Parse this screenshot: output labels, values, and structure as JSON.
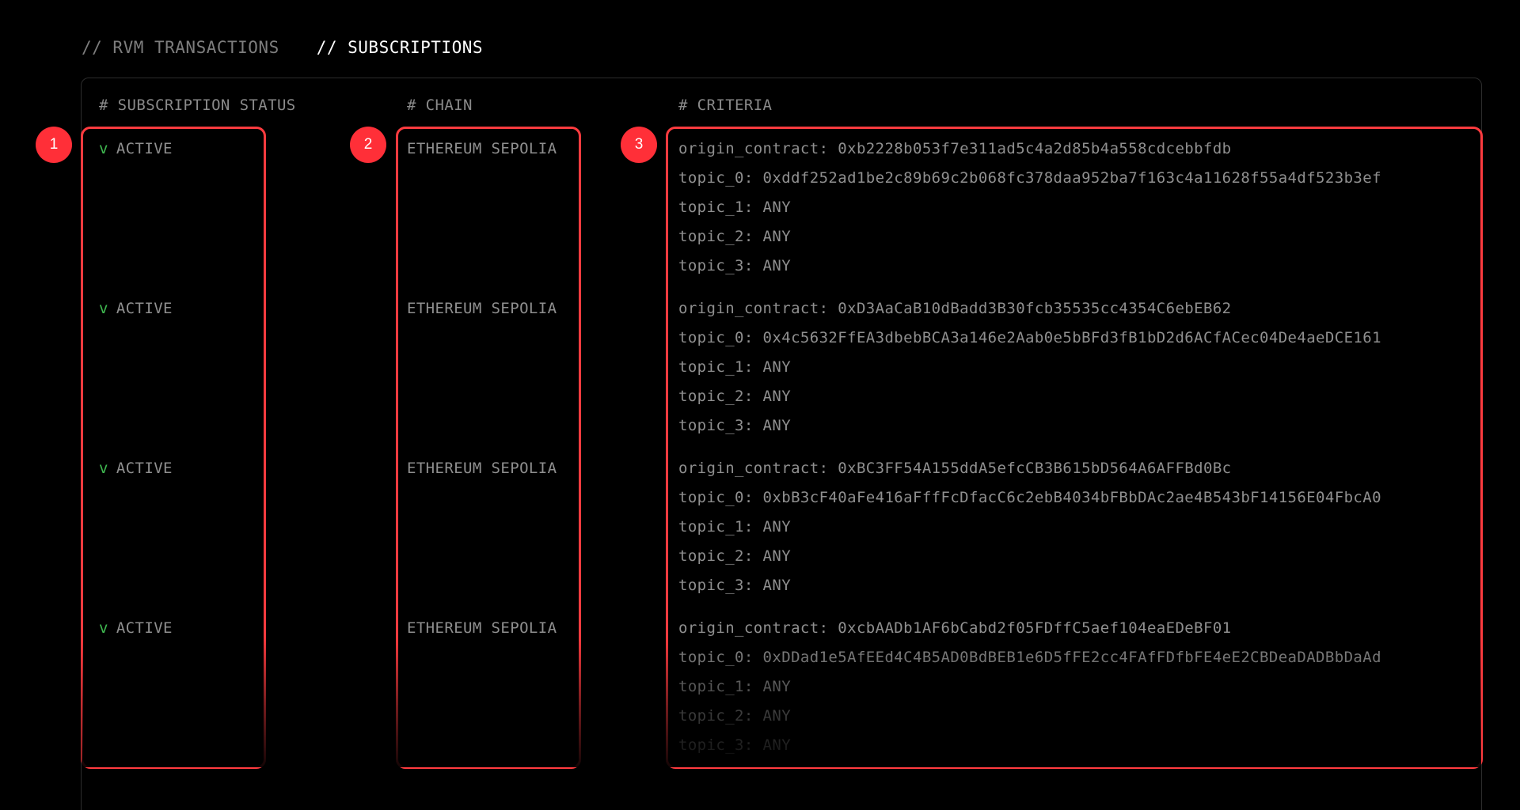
{
  "tabs": [
    {
      "label": "// RVM TRANSACTIONS",
      "active": false
    },
    {
      "label": "// SUBSCRIPTIONS",
      "active": true
    }
  ],
  "columns": {
    "status": "# SUBSCRIPTION STATUS",
    "chain": "# CHAIN",
    "criteria": "# CRITERIA"
  },
  "markers": [
    "1",
    "2",
    "3"
  ],
  "subscriptions": [
    {
      "check": "v",
      "status": "ACTIVE",
      "chain": "ETHEREUM SEPOLIA",
      "criteria": [
        "origin_contract: 0xb2228b053f7e311ad5c4a2d85b4a558cdcebbfdb",
        "topic_0: 0xddf252ad1be2c89b69c2b068fc378daa952ba7f163c4a11628f55a4df523b3ef",
        "topic_1: ANY",
        "topic_2: ANY",
        "topic_3: ANY"
      ]
    },
    {
      "check": "v",
      "status": "ACTIVE",
      "chain": "ETHEREUM SEPOLIA",
      "criteria": [
        "origin_contract: 0xD3AaCaB10dBadd3B30fcb35535cc4354C6ebEB62",
        "topic_0: 0x4c5632FfEA3dbebBCA3a146e2Aab0e5bBFd3fB1bD2d6ACfACec04De4aeDCE161",
        "topic_1: ANY",
        "topic_2: ANY",
        "topic_3: ANY"
      ]
    },
    {
      "check": "v",
      "status": "ACTIVE",
      "chain": "ETHEREUM SEPOLIA",
      "criteria": [
        "origin_contract: 0xBC3FF54A155ddA5efcCB3B615bD564A6AFFBd0Bc",
        "topic_0: 0xbB3cF40aFe416aFffFcDfacC6c2ebB4034bFBbDAc2ae4B543bF14156E04FbcA0",
        "topic_1: ANY",
        "topic_2: ANY",
        "topic_3: ANY"
      ]
    },
    {
      "check": "v",
      "status": "ACTIVE",
      "chain": "ETHEREUM SEPOLIA",
      "criteria": [
        "origin_contract: 0xcbAADb1AF6bCabd2f05FDffC5aef104eaEDeBF01",
        "topic_0: 0xDDad1e5AfEEd4C4B5AD0BdBEB1e6D5fFE2cc4FAfFDfbFE4eE2CBDeaDADBbDaAd",
        "topic_1: ANY",
        "topic_2: ANY",
        "topic_3: ANY"
      ]
    }
  ],
  "colors": {
    "highlight": "#ff3b3f",
    "marker": "#ff2f38",
    "check": "#3fb950",
    "background": "#000000"
  }
}
